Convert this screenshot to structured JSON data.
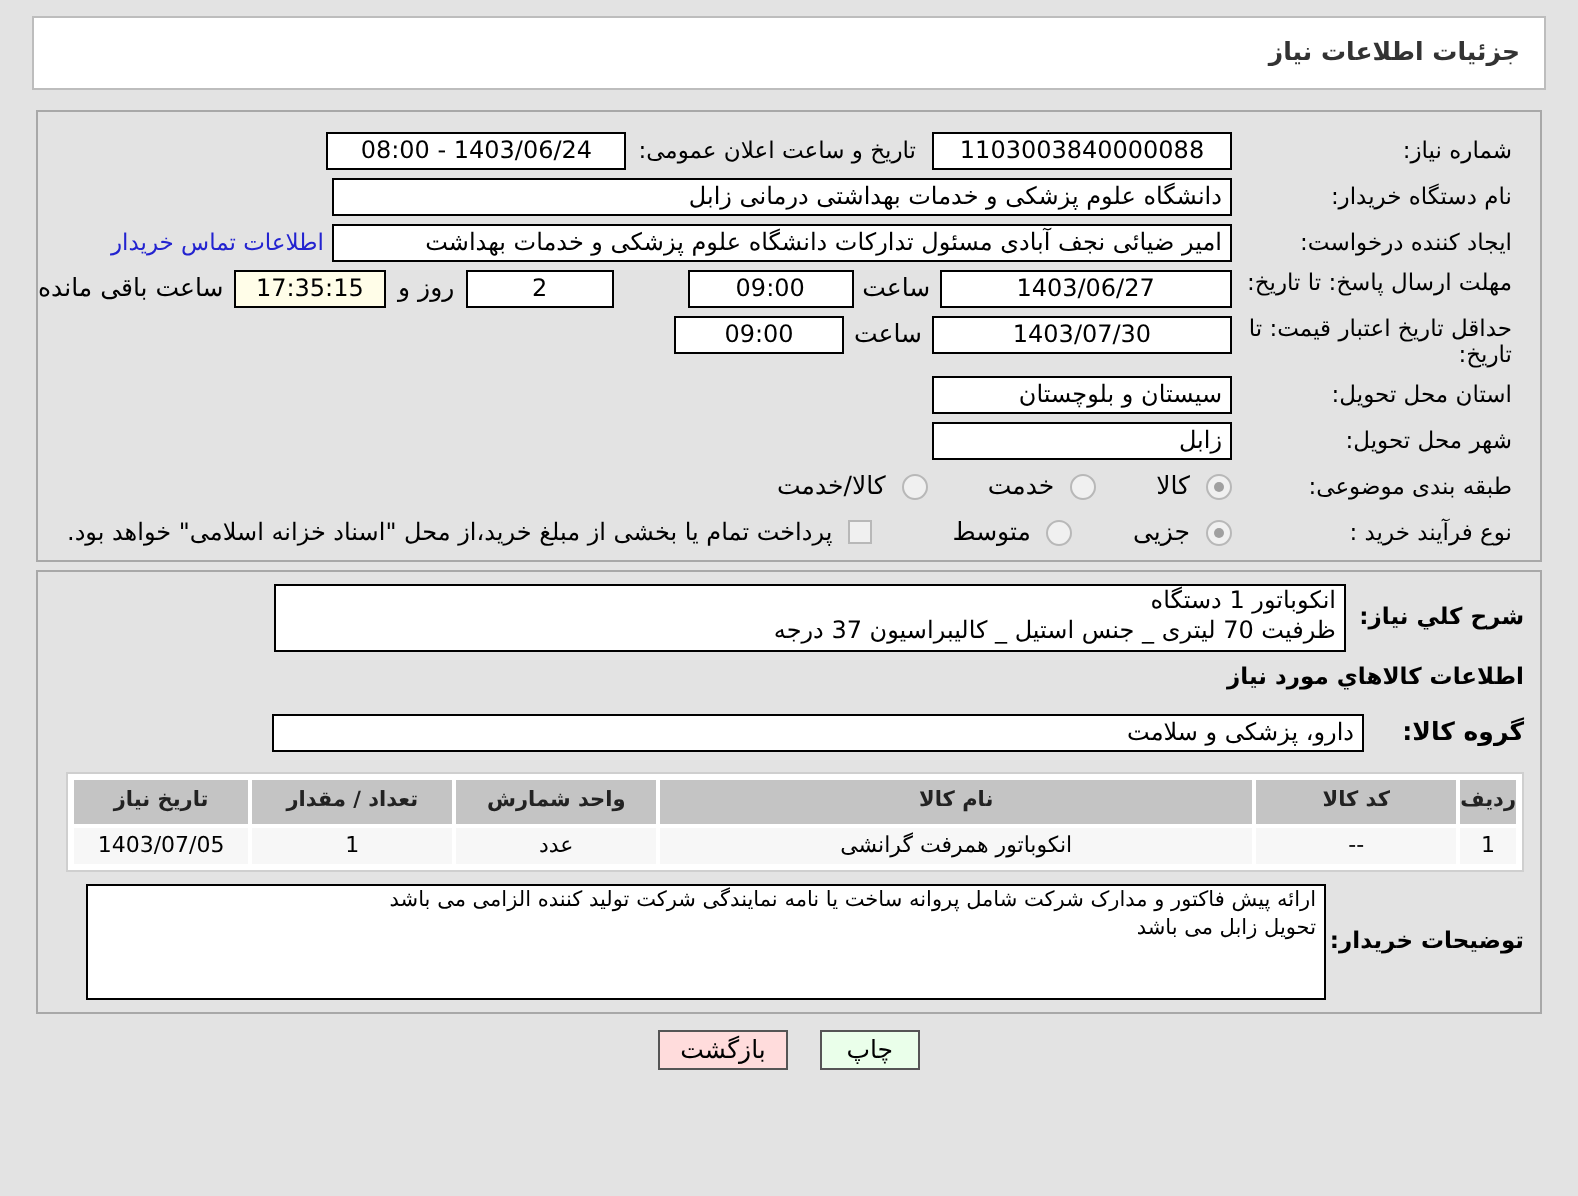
{
  "page_title": "جزئیات اطلاعات نیاز",
  "need_number": {
    "label": "شماره نیاز:",
    "value": "1103003840000088"
  },
  "announce": {
    "label": "تاریخ و ساعت اعلان عمومی:",
    "value": "1403/06/24 - 08:00"
  },
  "buyer": {
    "label": "نام دستگاه خریدار:",
    "value": "دانشگاه علوم پزشکی و خدمات بهداشتی درمانی زابل"
  },
  "creator": {
    "label": "ایجاد کننده درخواست:",
    "value": "امیر ضیائی نجف آبادی مسئول تدارکات  دانشگاه علوم پزشکی و خدمات بهداشت",
    "link": "اطلاعات تماس خریدار"
  },
  "deadline": {
    "label": "مهلت ارسال پاسخ: تا تاریخ:",
    "date": "1403/06/27",
    "time_label": "ساعت",
    "time": "09:00",
    "days": "2",
    "days_label": "روز و",
    "remaining": "17:35:15",
    "remaining_label": "ساعت باقی مانده"
  },
  "validity": {
    "label": "حداقل تاریخ اعتبار قیمت: تا تاریخ:",
    "date": "1403/07/30",
    "time_label": "ساعت",
    "time": "09:00"
  },
  "province": {
    "label": "استان محل تحویل:",
    "value": "سیستان و بلوچستان"
  },
  "city": {
    "label": "شهر محل تحویل:",
    "value": "زابل"
  },
  "category": {
    "label": "طبقه بندی موضوعی:",
    "options": [
      {
        "label": "کالا",
        "selected": true
      },
      {
        "label": "خدمت",
        "selected": false
      },
      {
        "label": "کالا/خدمت",
        "selected": false
      }
    ]
  },
  "process": {
    "label": "نوع فرآیند خرید :",
    "options": [
      {
        "label": "جزیی",
        "selected": true
      },
      {
        "label": "متوسط",
        "selected": false
      }
    ],
    "payment": {
      "label": "پرداخت تمام یا بخشی از مبلغ خرید،از محل \"اسناد خزانه اسلامی\" خواهد بود.",
      "checked": false
    }
  },
  "description": {
    "label": "شرح کلي نياز:",
    "lines": [
      "انکوباتور 1 دستگاه",
      "ظرفیت 70 لیتری _ جنس استیل _ کالیبراسیون 37 درجه"
    ]
  },
  "goods_title": "اطلاعات کالاهاي مورد نياز",
  "goods_group": {
    "label": "گروه کالا:",
    "value": "دارو، پزشکی و سلامت"
  },
  "table": {
    "columns": [
      "ردیف",
      "کد کالا",
      "نام کالا",
      "واحد شمارش",
      "تعداد / مقدار",
      "تاریخ نیاز"
    ],
    "rows": [
      [
        "1",
        "--",
        "انکوباتور همرفت گرانشی",
        "عدد",
        "1",
        "1403/07/05"
      ]
    ]
  },
  "buyer_notes": {
    "label": "توضیحات خریدار:",
    "lines": [
      "ارائه پیش فاکتور و مدارک شرکت شامل پروانه ساخت یا نامه نمایندگی شرکت تولید کننده الزامی می باشد",
      "تحویل زابل می باشد"
    ]
  },
  "buttons": [
    {
      "label": "چاپ",
      "kind": "print"
    },
    {
      "label": "بازگشت",
      "kind": "back"
    }
  ]
}
